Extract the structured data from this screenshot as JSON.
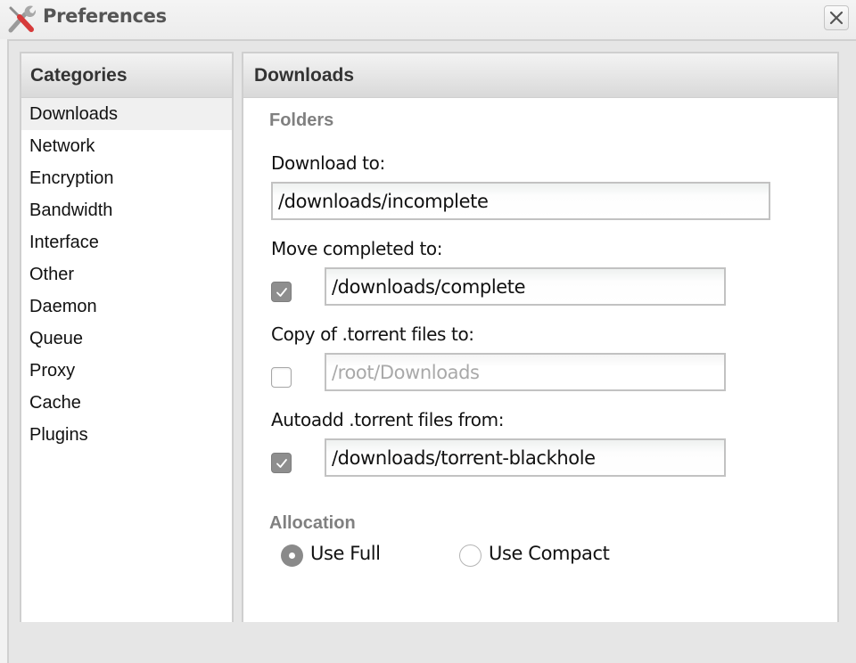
{
  "window": {
    "title": "Preferences",
    "icon": "tools-icon",
    "close_icon": "close-icon"
  },
  "categories": {
    "header": "Categories",
    "selected": "Downloads",
    "items": [
      {
        "label": "Downloads"
      },
      {
        "label": "Network"
      },
      {
        "label": "Encryption"
      },
      {
        "label": "Bandwidth"
      },
      {
        "label": "Interface"
      },
      {
        "label": "Other"
      },
      {
        "label": "Daemon"
      },
      {
        "label": "Queue"
      },
      {
        "label": "Proxy"
      },
      {
        "label": "Cache"
      },
      {
        "label": "Plugins"
      }
    ]
  },
  "content": {
    "header": "Downloads",
    "folders": {
      "title": "Folders",
      "download_to": {
        "label": "Download to:",
        "value": "/downloads/incomplete"
      },
      "move_completed": {
        "label": "Move completed to:",
        "checked": true,
        "value": "/downloads/complete"
      },
      "copy_torrent": {
        "label": "Copy of .torrent files to:",
        "checked": false,
        "value": "/root/Downloads"
      },
      "autoadd": {
        "label": "Autoadd .torrent files from:",
        "checked": true,
        "value": "/downloads/torrent-blackhole"
      }
    },
    "allocation": {
      "title": "Allocation",
      "options": [
        {
          "label": "Use Full",
          "selected": true
        },
        {
          "label": "Use Compact",
          "selected": false
        }
      ]
    }
  },
  "colors": {
    "section_title": "#808080",
    "checkbox_checked": "#8e8e8e",
    "selected_row": "#f0f0f0"
  }
}
